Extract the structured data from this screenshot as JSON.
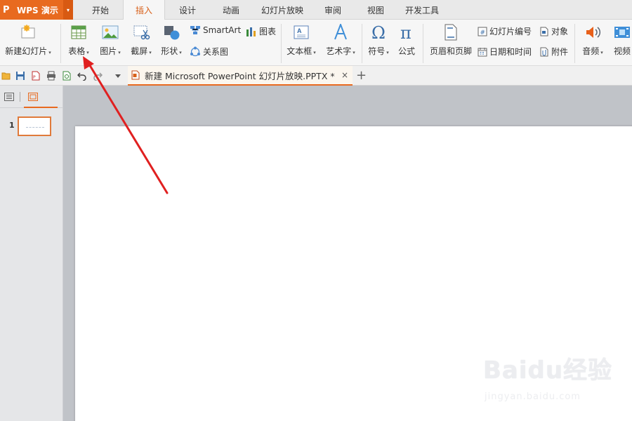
{
  "app": {
    "logo": "P",
    "title": "WPS 演示",
    "dropdown": "▾"
  },
  "menu_tabs": [
    {
      "label": "开始"
    },
    {
      "label": "插入"
    },
    {
      "label": "设计"
    },
    {
      "label": "动画"
    },
    {
      "label": "幻灯片放映"
    },
    {
      "label": "审阅"
    },
    {
      "label": "视图"
    },
    {
      "label": "开发工具"
    }
  ],
  "active_tab": "插入",
  "ribbon": {
    "new_slide": "新建幻灯片",
    "table": "表格",
    "picture": "图片",
    "screenshot": "截屏",
    "shape": "形状",
    "smartart": "SmartArt",
    "chart": "图表",
    "relation": "关系图",
    "textbox": "文本框",
    "wordart": "艺术字",
    "symbol": "符号",
    "formula": "公式",
    "header_footer": "页眉和页脚",
    "slide_number": "幻灯片编号",
    "object": "对象",
    "date_time": "日期和时间",
    "attachment": "附件",
    "audio": "音频",
    "video": "视频",
    "dropdown_arrow": "▾"
  },
  "document_tab": {
    "title": "新建 Microsoft PowerPoint 幻灯片放映.PPTX *",
    "close": "×",
    "new_tab": "+"
  },
  "slides_panel": {
    "slide_number": "1"
  },
  "watermark": {
    "line1": "Baidu经验",
    "line2": "jingyan.baidu.com"
  },
  "colors": {
    "accent": "#e86a1f",
    "arrow": "#e02020"
  }
}
